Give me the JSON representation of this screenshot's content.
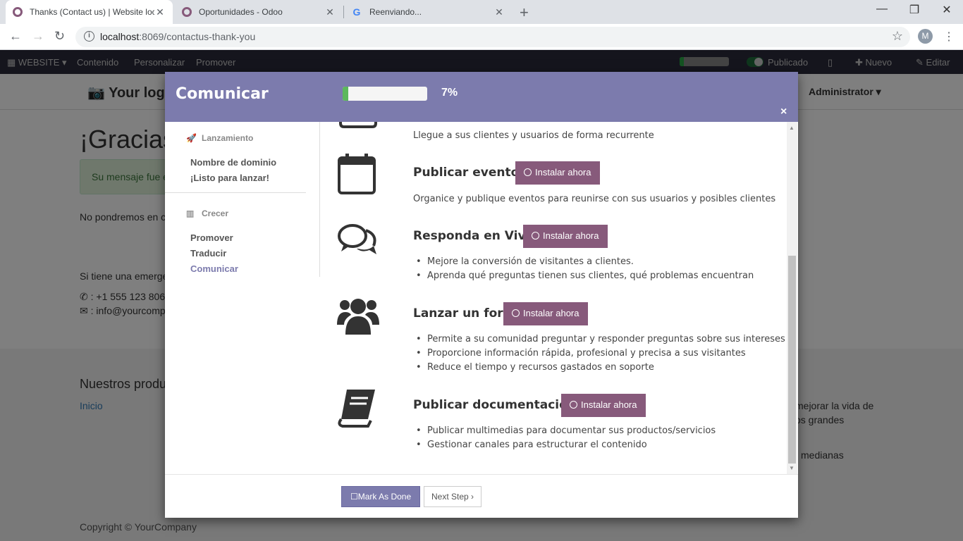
{
  "browser": {
    "tabs": [
      {
        "title": "Thanks (Contact us) | Website loc",
        "close": "✕"
      },
      {
        "title": "Oportunidades - Odoo",
        "close": "✕"
      },
      {
        "title": "Reenviando...",
        "close": "✕"
      }
    ],
    "url_host": "localhost",
    "url_rest": ":8069/contactus-thank-you",
    "profile_initial": "M"
  },
  "odoo_nav": {
    "website": "WEBSITE",
    "contenido": "Contenido",
    "personalizar": "Personalizar",
    "promover": "Promover",
    "publicado": "Publicado",
    "nuevo": "Nuevo",
    "editar": "Editar"
  },
  "page": {
    "logo": "Your log",
    "admin": "Administrator",
    "heading": "¡Gracias",
    "alert": "Su mensaje fue e",
    "line1": "No pondremos en c",
    "line2": "Si tiene una emerge",
    "phone": ": +1 555 123 806",
    "email": ": info@yourcomp",
    "footer_heading": "Nuestros produ",
    "footer_link": "Inicio",
    "footer_r1": "mejorar la vida de",
    "footer_r2": "os grandes",
    "footer_r3": "medianas",
    "copyright": "Copyright © YourCompany"
  },
  "modal": {
    "title": "Comunicar",
    "progress_percent": 7,
    "progress_label": "7%",
    "close": "×",
    "sidebar": {
      "section1": "Lanzamiento",
      "items1": [
        "Nombre de dominio",
        "¡Listo para lanzar!"
      ],
      "section2": "Crecer",
      "items2": [
        "Promover",
        "Traducir",
        "Comunicar"
      ]
    },
    "top_desc": "Llegue a sus clientes y usuarios de forma recurrente",
    "install_label": "Instalar ahora",
    "features": [
      {
        "title": "Publicar eventos",
        "desc": "Organice y publique eventos para reunirse con sus usuarios y posibles clientes",
        "icon": "calendar-icon"
      },
      {
        "title": "Responda en Vivo",
        "bullets": [
          "Mejore la conversión de visitantes a clientes.",
          "Aprenda qué preguntas tienen sus clientes, qué problemas encuentran"
        ],
        "icon": "comments-icon"
      },
      {
        "title": "Lanzar un foro",
        "bullets": [
          "Permite a su comunidad preguntar y responder preguntas sobre sus intereses",
          "Proporcione información rápida, profesional y precisa a sus visitantes",
          "Reduce el tiempo y recursos gastados en soporte"
        ],
        "icon": "users-icon"
      },
      {
        "title": "Publicar documentación",
        "bullets": [
          "Publicar multimedias para documentar sus productos/servicios",
          "Gestionar canales para estructurar el contenido"
        ],
        "icon": "book-icon"
      }
    ],
    "mark_done": "Mark As Done",
    "next_step": "Next Step"
  }
}
